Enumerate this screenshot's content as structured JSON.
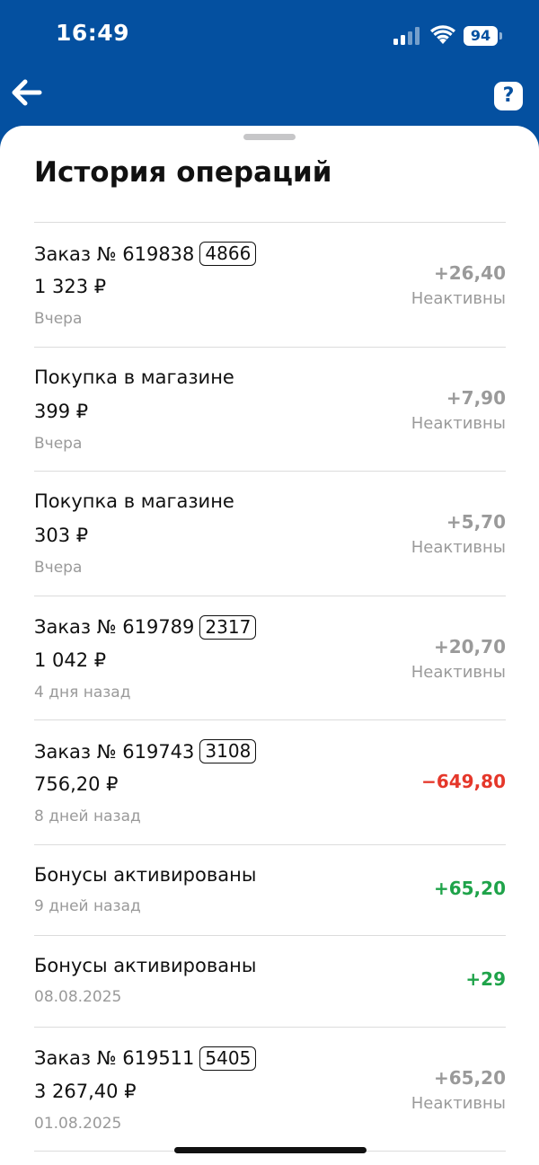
{
  "colors": {
    "header_bg": "#0450a0",
    "sheet_bg": "#ffffff",
    "inactive": "#9a9a9a",
    "positive": "#1fa34a",
    "negative": "#e5372a"
  },
  "status_bar": {
    "time": "16:49",
    "battery": "94",
    "icons": [
      "signal-icon",
      "wifi-icon",
      "battery-icon"
    ]
  },
  "header": {
    "back_icon": "arrow-left-icon",
    "help_label": "?"
  },
  "page": {
    "title": "История операций"
  },
  "operations": [
    {
      "title": "Заказ № 619838",
      "code": "4866",
      "amount": "1 323 ₽",
      "date": "Вчера",
      "bonus": "+26,40",
      "status": "Неактивны",
      "tone": "inactive"
    },
    {
      "title": "Покупка в магазине",
      "code": null,
      "amount": "399 ₽",
      "date": "Вчера",
      "bonus": "+7,90",
      "status": "Неактивны",
      "tone": "inactive"
    },
    {
      "title": "Покупка в магазине",
      "code": null,
      "amount": "303 ₽",
      "date": "Вчера",
      "bonus": "+5,70",
      "status": "Неактивны",
      "tone": "inactive"
    },
    {
      "title": "Заказ № 619789",
      "code": "2317",
      "amount": "1 042 ₽",
      "date": "4 дня назад",
      "bonus": "+20,70",
      "status": "Неактивны",
      "tone": "inactive"
    },
    {
      "title": "Заказ № 619743",
      "code": "3108",
      "amount": "756,20 ₽",
      "date": "8 дней назад",
      "bonus": "−649,80",
      "status": null,
      "tone": "negative"
    },
    {
      "title": "Бонусы активированы",
      "code": null,
      "amount": null,
      "date": "9 дней назад",
      "bonus": "+65,20",
      "status": null,
      "tone": "positive"
    },
    {
      "title": "Бонусы активированы",
      "code": null,
      "amount": null,
      "date": "08.08.2025",
      "bonus": "+29",
      "status": null,
      "tone": "positive"
    },
    {
      "title": "Заказ № 619511",
      "code": "5405",
      "amount": "3 267,40 ₽",
      "date": "01.08.2025",
      "bonus": "+65,20",
      "status": "Неактивны",
      "tone": "inactive"
    }
  ]
}
